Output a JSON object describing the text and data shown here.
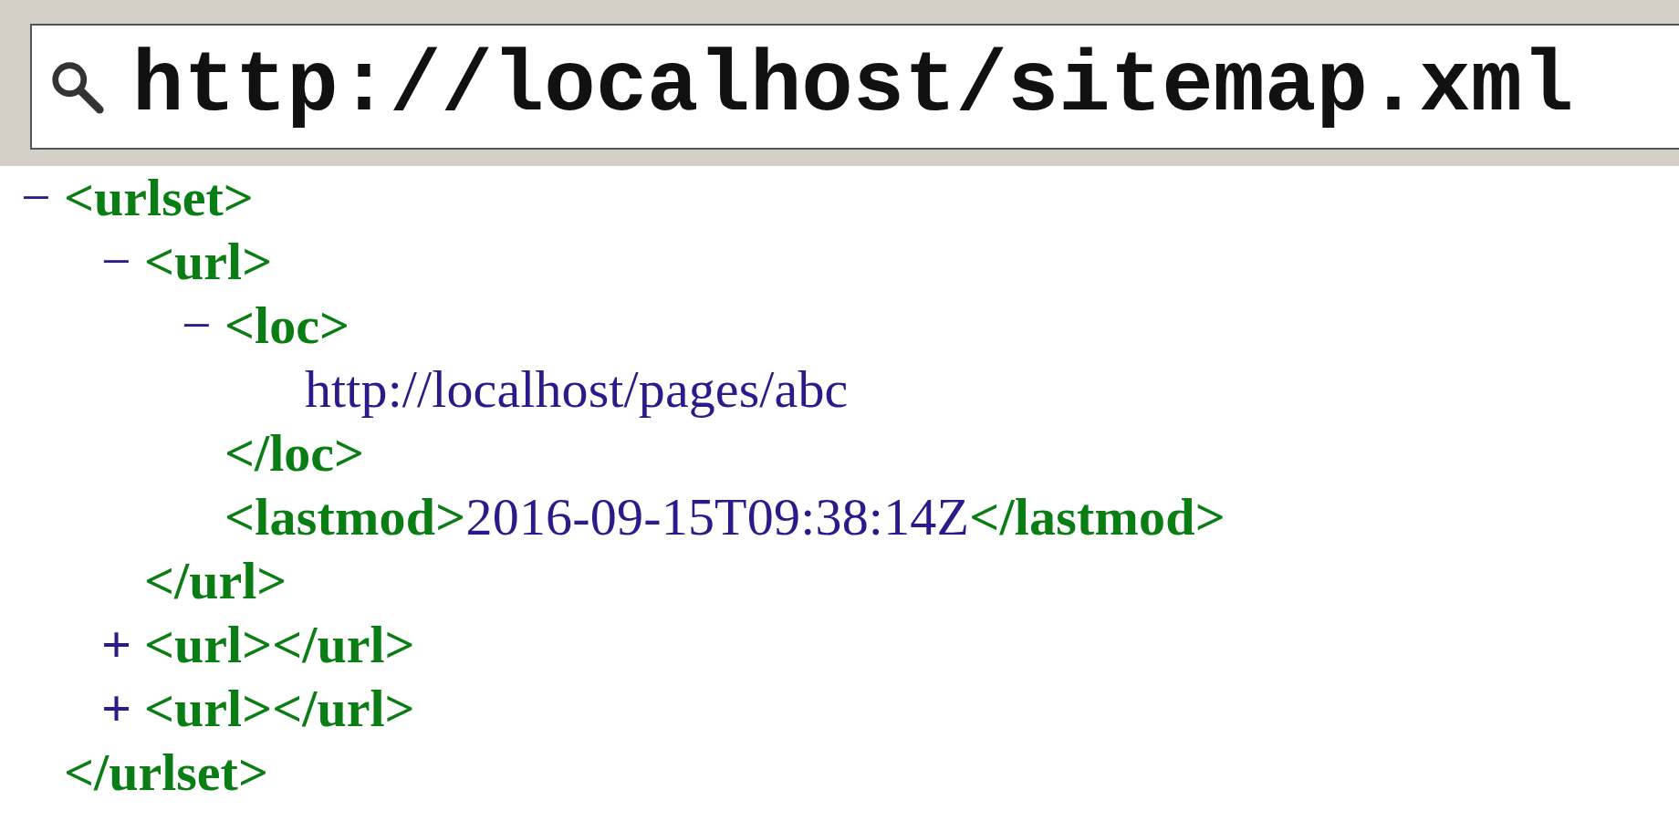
{
  "address_bar": {
    "url": "http://localhost/sitemap.xml"
  },
  "tree": {
    "toggle": "−",
    "open": "<urlset>",
    "close": "</urlset>",
    "expanded": true,
    "children": [
      {
        "toggle": "−",
        "open": "<url>",
        "close": "</url>",
        "expanded": true,
        "children": [
          {
            "toggle": "−",
            "open": "<loc>",
            "close": "</loc>",
            "expanded": true,
            "children": [
              {
                "text": "http://localhost/pages/abc"
              }
            ]
          },
          {
            "open": "<lastmod>",
            "text": "2016-09-15T09:38:14Z",
            "close": "</lastmod>"
          }
        ]
      },
      {
        "toggle": "+",
        "open": "<url>",
        "close": "</url>",
        "expanded": false
      },
      {
        "toggle": "+",
        "open": "<url>",
        "close": "</url>",
        "expanded": false
      }
    ]
  }
}
